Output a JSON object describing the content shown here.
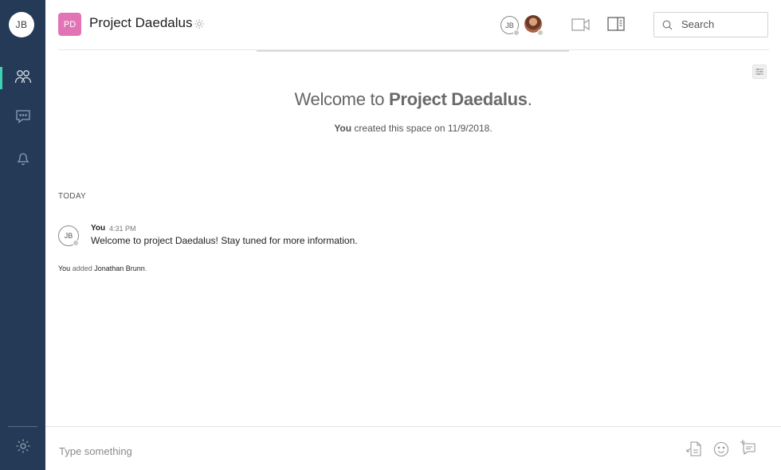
{
  "sidebar": {
    "user_initials": "JB",
    "nav": [
      {
        "id": "spaces",
        "icon": "people-icon",
        "active": true
      },
      {
        "id": "messages",
        "icon": "chat-bubble-icon",
        "active": false
      },
      {
        "id": "notifications",
        "icon": "bell-icon",
        "active": false
      }
    ],
    "settings_icon": "gear-icon",
    "accent_color": "#3fd1b4",
    "background_color": "#243a56"
  },
  "header": {
    "space_initials": "PD",
    "space_badge_color": "#e274b6",
    "space_title": "Project Daedalus",
    "member_initials": "JB",
    "search_placeholder": "Search"
  },
  "main": {
    "welcome_prefix": "Welcome to ",
    "welcome_space": "Project Daedalus",
    "welcome_suffix": ".",
    "created_by": "You",
    "created_text": " created this space on 11/9/2018.",
    "day_separator": "TODAY",
    "messages": [
      {
        "initials": "JB",
        "author": "You",
        "time": "4:31 PM",
        "text": "Welcome to project Daedalus! Stay tuned for more information."
      }
    ],
    "system_note": {
      "actor": "You",
      "action": " added ",
      "target": "Jonathan Brunn",
      "end": "."
    }
  },
  "composer": {
    "placeholder": "Type something"
  }
}
